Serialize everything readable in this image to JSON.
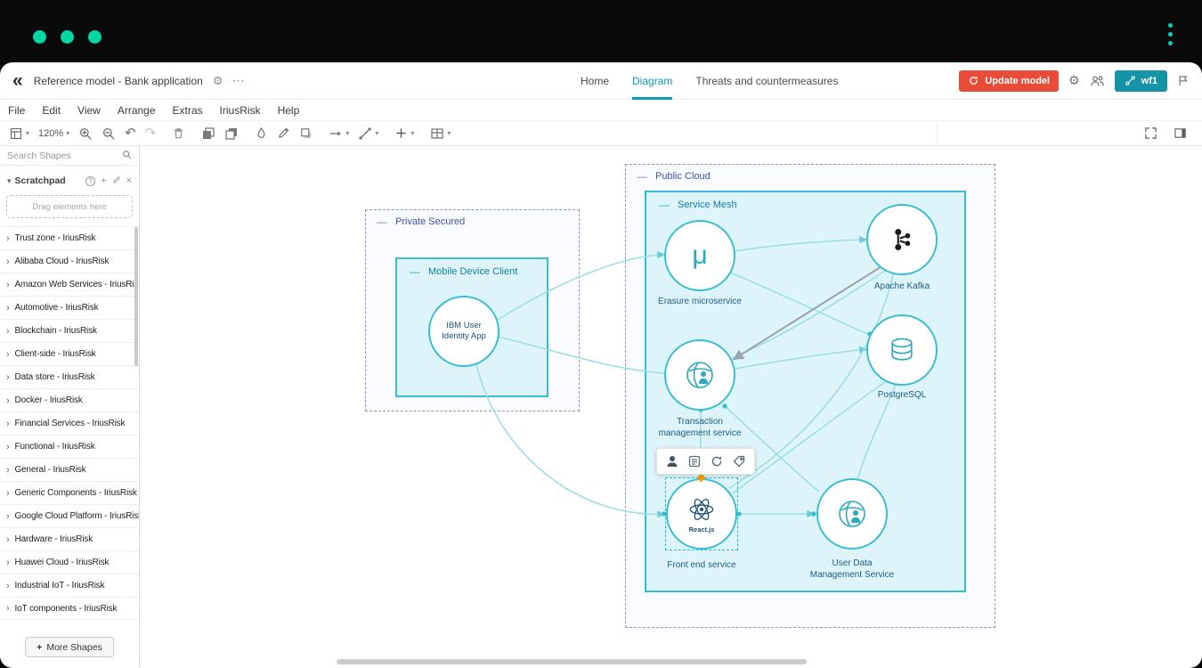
{
  "header": {
    "title": "Reference model - Bank application",
    "tabs": [
      {
        "label": "Home"
      },
      {
        "label": "Diagram"
      },
      {
        "label": "Threats and countermeasures"
      }
    ],
    "active_tab": "Diagram",
    "update_button": "Update model",
    "workflow_button": "wf1"
  },
  "menubar": {
    "items": [
      "File",
      "Edit",
      "View",
      "Arrange",
      "Extras",
      "IriusRisk",
      "Help"
    ]
  },
  "toolbar": {
    "zoom": "120%"
  },
  "sidebar": {
    "search_placeholder": "Search Shapes",
    "scratchpad_label": "Scratchpad",
    "dropzone_text": "Drag elements here",
    "sections": [
      "Trust zone - IriusRisk",
      "Alibaba Cloud - IriusRisk",
      "Amazon Web Services - IriusRisk",
      "Automotive - IriusRisk",
      "Blockchain - IriusRisk",
      "Client-side - IriusRisk",
      "Data store - IriusRisk",
      "Docker - IriusRisk",
      "Financial Services - IriusRisk",
      "Functional - IriusRisk",
      "General - IriusRisk",
      "Generic Components - IriusRisk",
      "Google Cloud Platform - IriusRisk",
      "Hardware - IriusRisk",
      "Huawei Cloud - IriusRisk",
      "Industrial IoT - IriusRisk",
      "IoT components - IriusRisk"
    ],
    "more_shapes_label": "More Shapes"
  },
  "diagram": {
    "zones": [
      {
        "label": "Private Secured"
      },
      {
        "label": "Public Cloud"
      }
    ],
    "groups": [
      {
        "label": "Mobile Device Client"
      },
      {
        "label": "Service Mesh"
      }
    ],
    "nodes": [
      {
        "id": "ibm-user-identity",
        "label": "IBM User Identity App"
      },
      {
        "id": "erasure-microservice",
        "label": "Erasure microservice",
        "glyph": "μ"
      },
      {
        "id": "apache-kafka",
        "label": "Apache Kafka"
      },
      {
        "id": "transaction-management",
        "label": "Transaction management service"
      },
      {
        "id": "postgresql",
        "label": "PostgreSQL"
      },
      {
        "id": "front-end-service",
        "label": "Front end service",
        "badge": "React.js"
      },
      {
        "id": "user-data-management",
        "label": "User Data Management Service"
      }
    ]
  },
  "icons": {
    "collapse": "«",
    "gear": "⚙",
    "ellipsis": "⋯",
    "caret_down": "▾",
    "undo": "↶",
    "redo": "↷",
    "chevron_down": "▾",
    "chevron_right": "›",
    "help": "?",
    "plus": "+",
    "close": "×",
    "minus": "—"
  },
  "colors": {
    "brand_green": "#00d6a2",
    "tab_teal": "#0d9cb2",
    "update_red": "#e84b37",
    "workflow_teal": "#1494a6",
    "node_border": "#38bdd0",
    "zone_border": "#8a93ce",
    "group_fill": "#d5f3f8",
    "node_label": "#1d5c86",
    "edge_teal": "#9edde6"
  }
}
